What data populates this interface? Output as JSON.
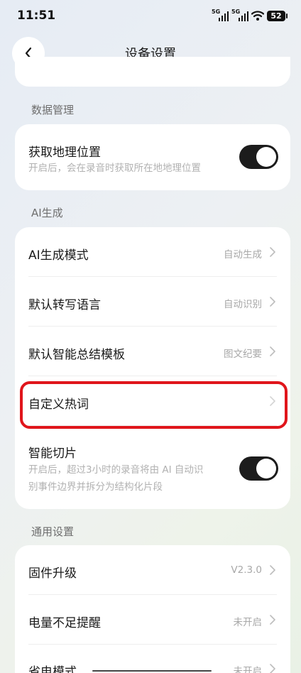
{
  "status_bar": {
    "time": "11:51",
    "signal1_label": "5G",
    "signal2_label": "5G",
    "battery": "52"
  },
  "header": {
    "title": "设备设置"
  },
  "sections": {
    "data_management": {
      "title": "数据管理",
      "location": {
        "title": "获取地理位置",
        "subtitle": "开启后，会在录音时获取所在地地理位置",
        "enabled": true
      }
    },
    "ai": {
      "title": "AI生成",
      "mode": {
        "title": "AI生成模式",
        "value": "自动生成"
      },
      "language": {
        "title": "默认转写语言",
        "value": "自动识别"
      },
      "template": {
        "title": "默认智能总结模板",
        "value": "图文纪要"
      },
      "hotwords": {
        "title": "自定义热词"
      },
      "slicing": {
        "title": "智能切片",
        "subtitle_line1": "开启后，超过3小时的录音将由 AI 自动识",
        "subtitle_line2": "别事件边界并拆分为结构化片段",
        "enabled": true
      }
    },
    "general": {
      "title": "通用设置",
      "firmware": {
        "title": "固件升级",
        "value": "V2.3.0"
      },
      "low_battery": {
        "title": "电量不足提醒",
        "value": "未开启"
      },
      "power_saving": {
        "title": "省电模式",
        "value": "未开启"
      }
    }
  },
  "colors": {
    "highlight": "#e0151b",
    "toggle_on": "#1c1c1c"
  }
}
